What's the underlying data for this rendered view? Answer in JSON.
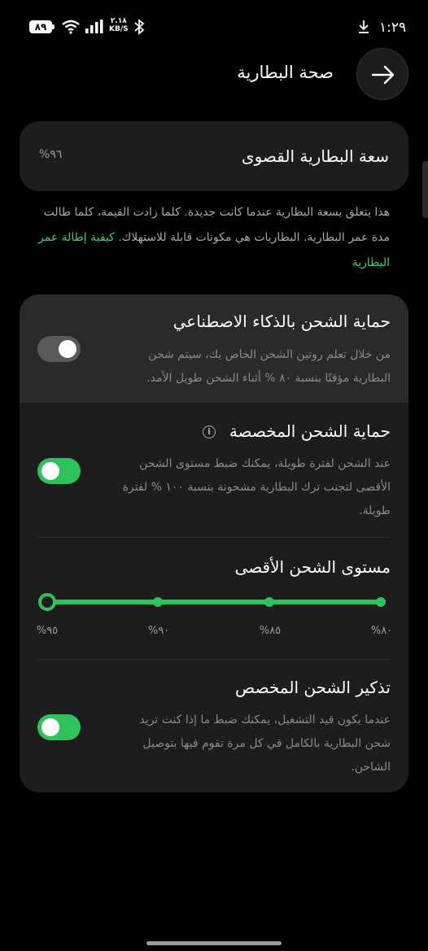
{
  "status_bar": {
    "time": "١:٢٩",
    "battery": "٨٩",
    "net_speed_value": "٢.١٨",
    "net_speed_unit": "KB/S",
    "icons": [
      "download-icon",
      "battery-icon",
      "wifi-icon",
      "signal-icon",
      "bluetooth-icon"
    ]
  },
  "header": {
    "title": "صحة البطارية",
    "back_icon": "arrow-right-icon"
  },
  "capacity": {
    "title": "سعة البطارية القصوى",
    "value": "%٩٦"
  },
  "info": {
    "text": "هذا يتعلق بسعة البطارية عندما كانت جديدة. كلما زادت القيمة، كلما طالت مدة عمر البطارية. البطاريات هي مكونات قابلة للاستهلاك.",
    "link": "كيفية إطالة عمر البطارية"
  },
  "ai_protection": {
    "title": "حماية الشحن بالذكاء الاصطناعي",
    "description": "من خلال تعلم روتين الشحن الخاص بك، سيتم شحن البطارية مؤقتًا بنسبة ٨٠ % أثناء الشحن طويل الأمد.",
    "enabled": false
  },
  "custom_protection": {
    "title": "حماية الشحن المخصصة",
    "description": "عند الشحن لفترة طويلة، يمكنك ضبط مستوى الشحن الأقصى لتجنب ترك البطارية مشحونة بنسبة ١٠٠ % لفترة طويلة.",
    "enabled": true
  },
  "max_level": {
    "title": "مستوى الشحن الأقصى",
    "ticks": [
      "%٩٥",
      "%٩٠",
      "%٨٥",
      "%٨٠"
    ],
    "selected": "%٩٥"
  },
  "reminder": {
    "title": "تذكير الشحن المخصص",
    "description": "عندما يكون قيد التشغيل، يمكنك ضبط ما إذا كنت تريد شحن البطارية بالكامل في كل مرة تقوم فيها بتوصيل الشاحن.",
    "enabled": true
  },
  "colors": {
    "accent": "#2fc25b",
    "link": "#3ed068",
    "card": "#1d1d1f",
    "background": "#000000"
  }
}
